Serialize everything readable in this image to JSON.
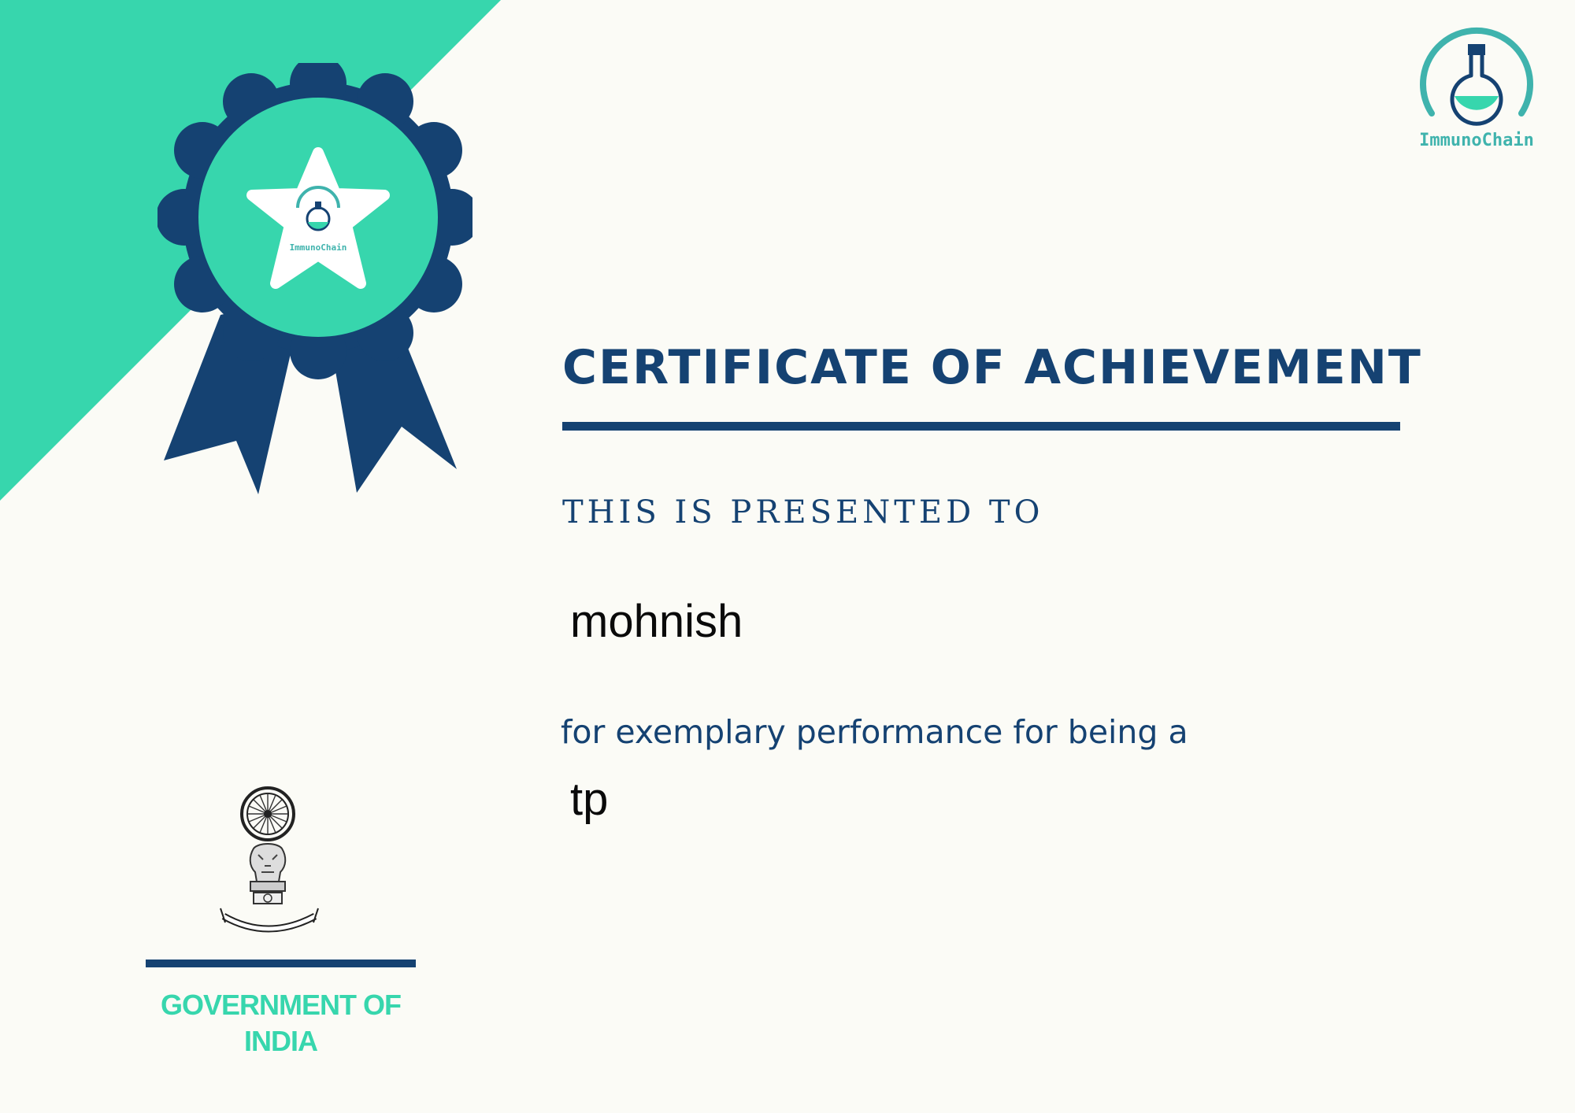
{
  "colors": {
    "accent_green": "#37d6ad",
    "navy": "#154272",
    "background": "#fbfbf6",
    "logo_teal": "#3fb3ad"
  },
  "brand": {
    "name": "ImmunoChain",
    "icon": "flask-icon"
  },
  "badge": {
    "icon": "award-ribbon-icon",
    "logo_text": "ImmunoChain"
  },
  "certificate": {
    "title": "CERTIFICATE OF ACHIEVEMENT",
    "presented_label": "THIS IS PRESENTED TO",
    "recipient": "mohnish",
    "reason": "for exemplary performance for being a",
    "role": "tp"
  },
  "issuer": {
    "emblem_icon": "national-emblem-icon",
    "name": "GOVERNMENT OF INDIA"
  }
}
